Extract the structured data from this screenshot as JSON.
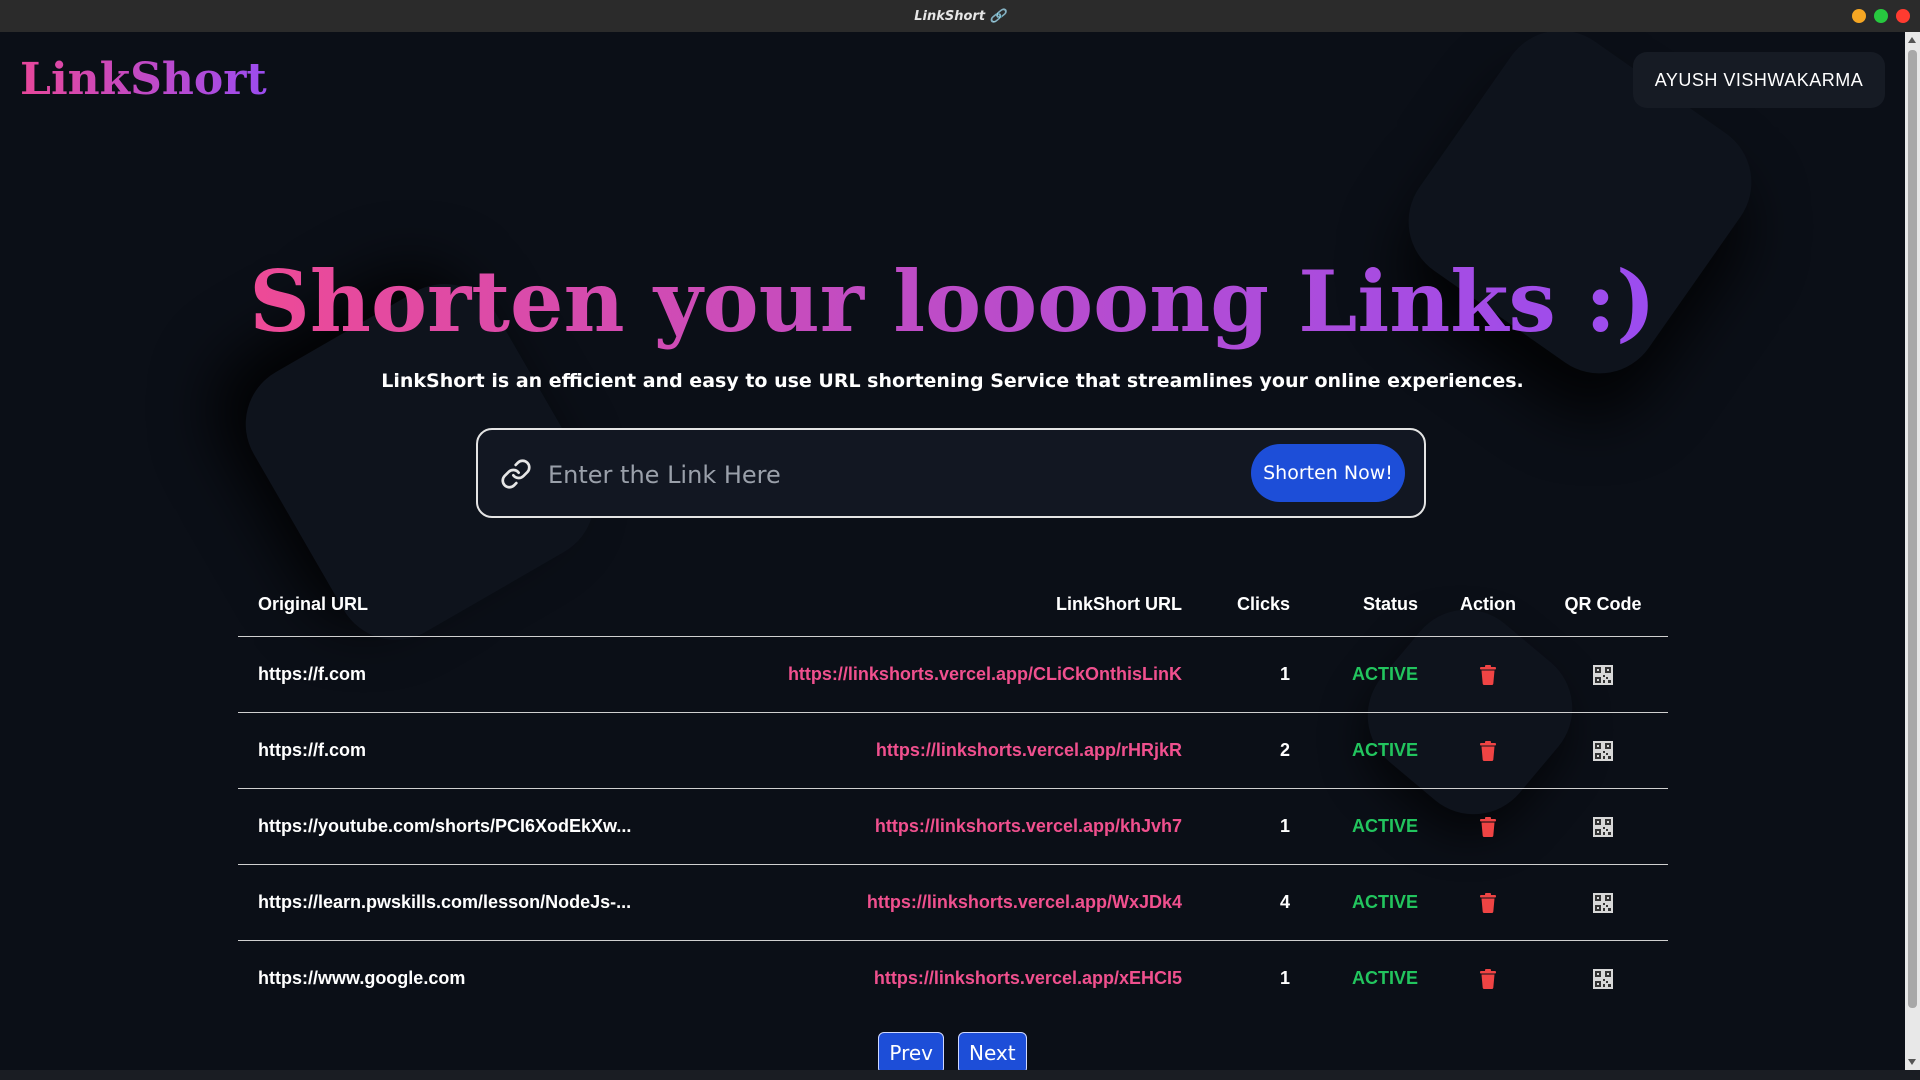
{
  "window": {
    "title": "LinkShort 🔗",
    "controls": [
      "#f5a623",
      "#27c93f",
      "#ff3b30"
    ]
  },
  "header": {
    "logo": "LinkShort",
    "user_name": "AYUSH VISHWAKARMA"
  },
  "hero": {
    "title": "Shorten your loooong Links :)",
    "subtitle": "LinkShort is an efficient and easy to use URL shortening Service that streamlines your online experiences."
  },
  "search": {
    "placeholder": "Enter the Link Here",
    "value": "",
    "button_label": "Shorten Now!"
  },
  "table": {
    "headers": {
      "original": "Original URL",
      "short": "LinkShort URL",
      "clicks": "Clicks",
      "status": "Status",
      "action": "Action",
      "qr": "QR Code"
    },
    "rows": [
      {
        "original": "https://f.com",
        "short": "https://linkshorts.vercel.app/CLiCkOnthisLinK",
        "clicks": "1",
        "status": "ACTIVE"
      },
      {
        "original": "https://f.com",
        "short": "https://linkshorts.vercel.app/rHRjkR",
        "clicks": "2",
        "status": "ACTIVE"
      },
      {
        "original": "https://youtube.com/shorts/PCI6XodEkXw...",
        "short": "https://linkshorts.vercel.app/khJvh7",
        "clicks": "1",
        "status": "ACTIVE"
      },
      {
        "original": "https://learn.pwskills.com/lesson/NodeJs-...",
        "short": "https://linkshorts.vercel.app/WxJDk4",
        "clicks": "4",
        "status": "ACTIVE"
      },
      {
        "original": "https://www.google.com",
        "short": "https://linkshorts.vercel.app/xEHCI5",
        "clicks": "1",
        "status": "ACTIVE"
      }
    ]
  },
  "pagination": {
    "prev_label": "Prev",
    "next_label": "Next"
  },
  "colors": {
    "accent_pink": "#f0508e",
    "accent_purple": "#9b4cf0",
    "button_blue": "#1d4ed8",
    "status_green": "#22c55e",
    "delete_red": "#ef4444"
  }
}
